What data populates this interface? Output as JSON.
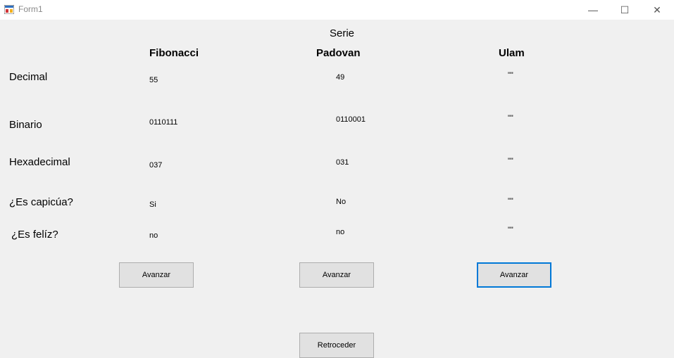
{
  "window": {
    "title": "Form1",
    "minimize_glyph": "—",
    "maximize_glyph": "☐",
    "close_glyph": "✕"
  },
  "header": {
    "serie_label": "Serie"
  },
  "columns": [
    "Fibonacci",
    "Padovan",
    "Ulam"
  ],
  "rows": [
    {
      "label": "Decimal",
      "values": [
        "55",
        "49",
        "\"\""
      ]
    },
    {
      "label": "Binario",
      "values": [
        "0110111",
        "0110001",
        "\"\""
      ]
    },
    {
      "label": "Hexadecimal",
      "values": [
        "037",
        "031",
        "\"\""
      ]
    },
    {
      "label": "¿Es capicúa?",
      "values": [
        "Si",
        "No",
        "\"\""
      ]
    },
    {
      "label": "¿Es felíz?",
      "values": [
        "no",
        "no",
        "\"\""
      ]
    }
  ],
  "buttons": {
    "advance": [
      "Avanzar",
      "Avanzar",
      "Avanzar"
    ],
    "back": "Retroceder"
  },
  "colors": {
    "focus_accent": "#0078d7"
  }
}
